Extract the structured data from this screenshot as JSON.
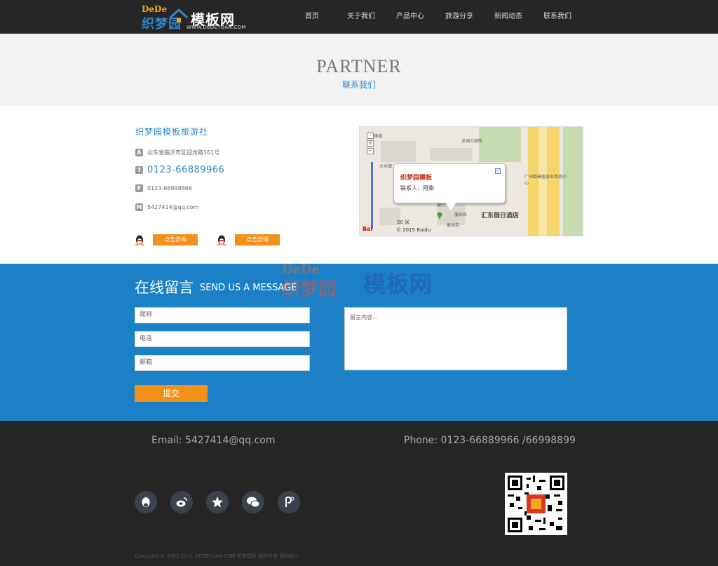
{
  "header": {
    "logo": {
      "dede": "DeDe",
      "main": "织梦园",
      "brand": "模板网",
      "url": "WWW.DEDEYUAN.COM"
    },
    "nav": [
      "首页",
      "关于我们",
      "产品中心",
      "旅游分享",
      "新闻动态",
      "联系我们"
    ]
  },
  "banner": {
    "title": "PARTNER",
    "subtitle": "联系我们"
  },
  "contact": {
    "company": "织梦园模板旅游社",
    "address": "山东省临沂市区迎龙路161号",
    "phone": "0123-66889966",
    "fax": "0123-66998866",
    "email": "5427414@qq.com",
    "icons": {
      "address": "A",
      "phone": "T",
      "fax": "F",
      "email": "M"
    },
    "qq_buttons": [
      "点击咨询",
      "点击咨询"
    ]
  },
  "map": {
    "popup_title": "织梦园模板",
    "popup_line": "联系人：阿柴",
    "hotel": "汇东假日酒店",
    "scale": "50 米",
    "copyright": "© 2015 Baidu",
    "labels": {
      "l1": "龙洞工商所",
      "l2": "大众银",
      "l3": "广州御景居旅业商务中心",
      "l4": "麦当劳",
      "l5": "服饰民",
      "l6": "银行",
      "l7": "雍城"
    }
  },
  "message": {
    "title": "在线留言",
    "subtitle": "SEND US A MESSAGE",
    "watermark": {
      "dede": "DeDe",
      "main": "织梦园",
      "brand": "模板网"
    },
    "fields": {
      "name": "昵称",
      "phone": "电话",
      "email": "邮箱"
    },
    "textarea": "留言内容...",
    "submit": "提交"
  },
  "footer": {
    "email": "Email: 5427414@qq.com",
    "phone": "Phone: 0123-66889966 /66998899",
    "social": [
      "qq-icon",
      "weibo-icon",
      "star-icon",
      "wechat-icon",
      "p-icon"
    ],
    "copyright": "Copyright © 2002-2011 DEDEYUAN.COM 织梦模板 版权所有 网站统计"
  }
}
